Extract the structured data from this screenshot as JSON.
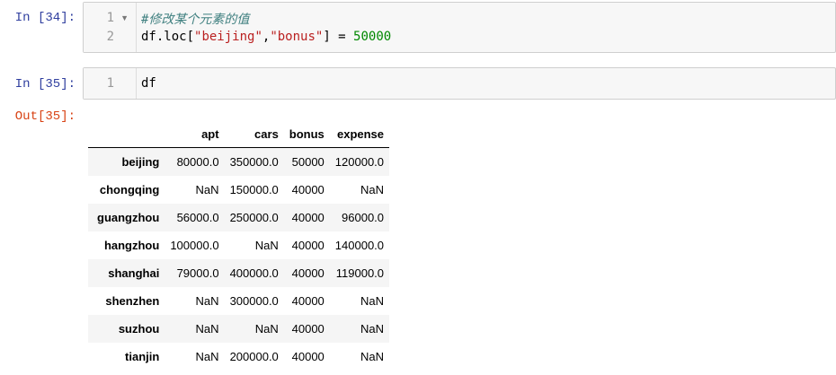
{
  "cells": [
    {
      "prompt": "In [34]:",
      "lines": [
        "1",
        "2"
      ],
      "comment": "#修改某个元素的值",
      "code2": {
        "a": "df.loc[",
        "s1": "\"beijing\"",
        "c": ",",
        "s2": "\"bonus\"",
        "b": "] = ",
        "n": "50000"
      }
    },
    {
      "prompt": "In [35]:",
      "lines": [
        "1"
      ],
      "code": "df",
      "out_prompt": "Out[35]:"
    }
  ],
  "table": {
    "columns": [
      "",
      "apt",
      "cars",
      "bonus",
      "expense"
    ],
    "rows": [
      [
        "beijing",
        "80000.0",
        "350000.0",
        "50000",
        "120000.0"
      ],
      [
        "chongqing",
        "NaN",
        "150000.0",
        "40000",
        "NaN"
      ],
      [
        "guangzhou",
        "56000.0",
        "250000.0",
        "40000",
        "96000.0"
      ],
      [
        "hangzhou",
        "100000.0",
        "NaN",
        "40000",
        "140000.0"
      ],
      [
        "shanghai",
        "79000.0",
        "400000.0",
        "40000",
        "119000.0"
      ],
      [
        "shenzhen",
        "NaN",
        "300000.0",
        "40000",
        "NaN"
      ],
      [
        "suzhou",
        "NaN",
        "NaN",
        "40000",
        "NaN"
      ],
      [
        "tianjin",
        "NaN",
        "200000.0",
        "40000",
        "NaN"
      ]
    ]
  }
}
